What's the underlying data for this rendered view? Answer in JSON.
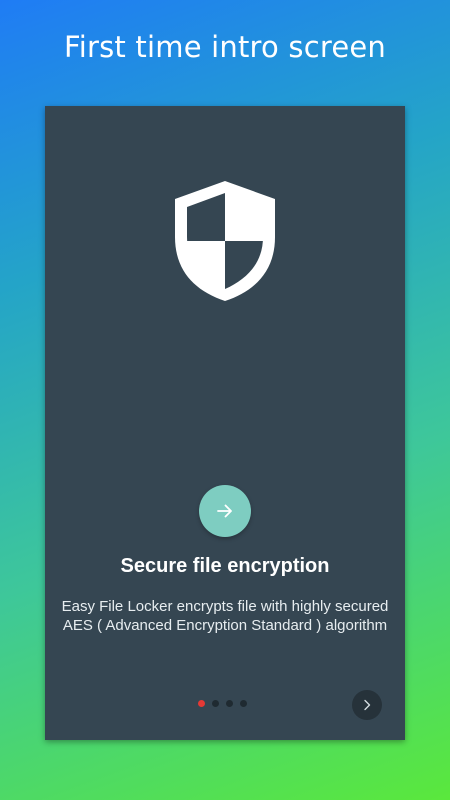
{
  "header": {
    "title": "First time intro screen"
  },
  "slide": {
    "icon": "shield-icon",
    "title": "Secure file encryption",
    "description": "Easy File Locker encrypts file with highly secured AES ( Advanced Encryption Standard ) algorithm"
  },
  "pager": {
    "page_count": 4,
    "current_page": 1,
    "active_color": "#e53935",
    "inactive_color": "#1f2a31"
  },
  "buttons": {
    "main_next_icon": "arrow-right-icon",
    "corner_next_icon": "chevron-right-icon"
  },
  "colors": {
    "panel": "#354652",
    "fab": "#7ecdc1",
    "gradient_start": "#1f7cf5",
    "gradient_end": "#5ae83c"
  }
}
